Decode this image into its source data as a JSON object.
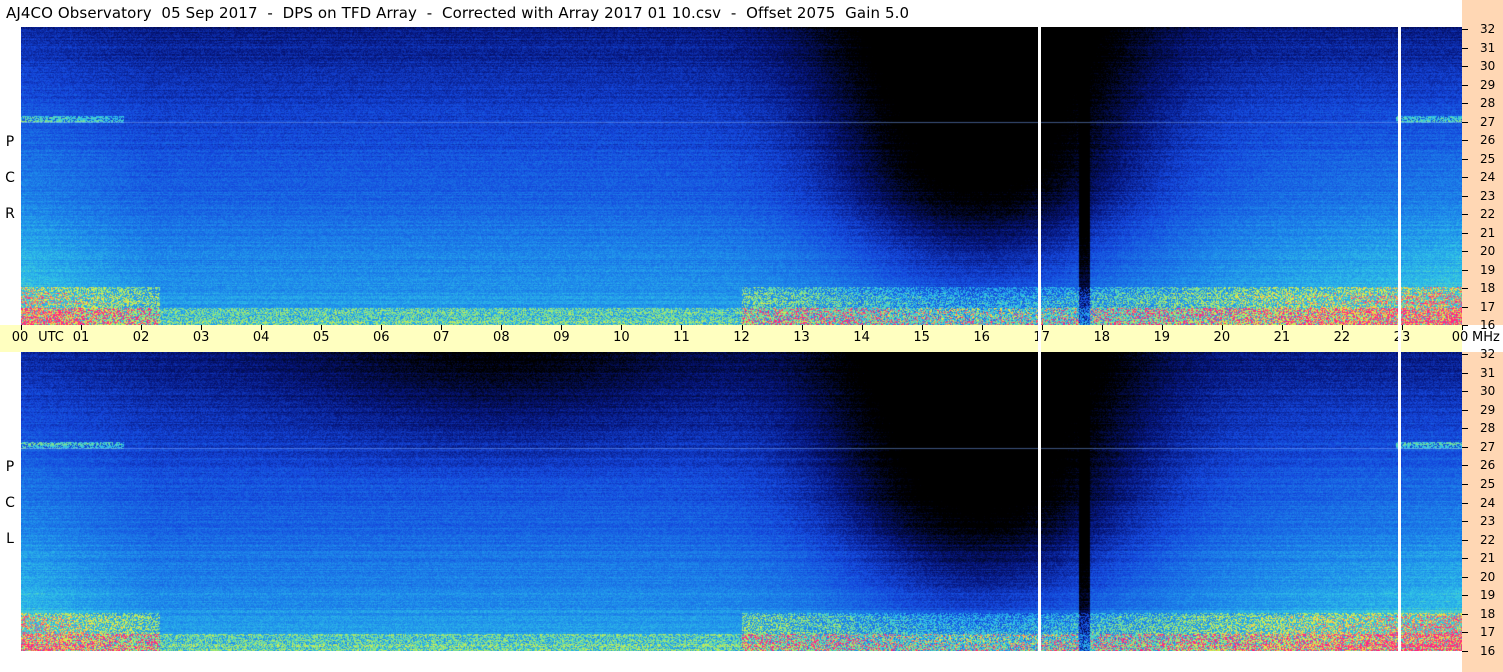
{
  "title": "AJ4CO Observatory  05 Sep 2017  -  DPS on TFD Array  -  Corrected with Array 2017 01 10.csv  -  Offset 2075  Gain 5.0",
  "panels": [
    {
      "label": [
        "R",
        "C",
        "P"
      ]
    },
    {
      "label": [
        "L",
        "C",
        "P"
      ]
    }
  ],
  "utc_unit": "UTC",
  "mhz_unit": "MHz",
  "chart_data": {
    "type": "heatmap",
    "title": "AJ4CO Observatory  05 Sep 2017  -  DPS on TFD Array  -  Corrected with Array 2017 01 10.csv  -  Offset 2075  Gain 5.0",
    "x_label": "UTC",
    "y_label": "MHz",
    "x_ticks": [
      "00",
      "01",
      "02",
      "03",
      "04",
      "05",
      "06",
      "07",
      "08",
      "09",
      "10",
      "11",
      "12",
      "13",
      "14",
      "15",
      "16",
      "17",
      "18",
      "19",
      "20",
      "21",
      "22",
      "23",
      "00"
    ],
    "y_ticks": [
      16,
      17,
      18,
      19,
      20,
      21,
      22,
      23,
      24,
      25,
      26,
      27,
      28,
      29,
      30,
      31,
      32
    ],
    "ylim": [
      16,
      32
    ],
    "panels": [
      "RCP",
      "LCP"
    ],
    "colors": {
      "low": "#000000",
      "mid": "#1464e6",
      "high": "#30c8e6",
      "peak": "#f0f050",
      "max": "#ff2070"
    }
  }
}
